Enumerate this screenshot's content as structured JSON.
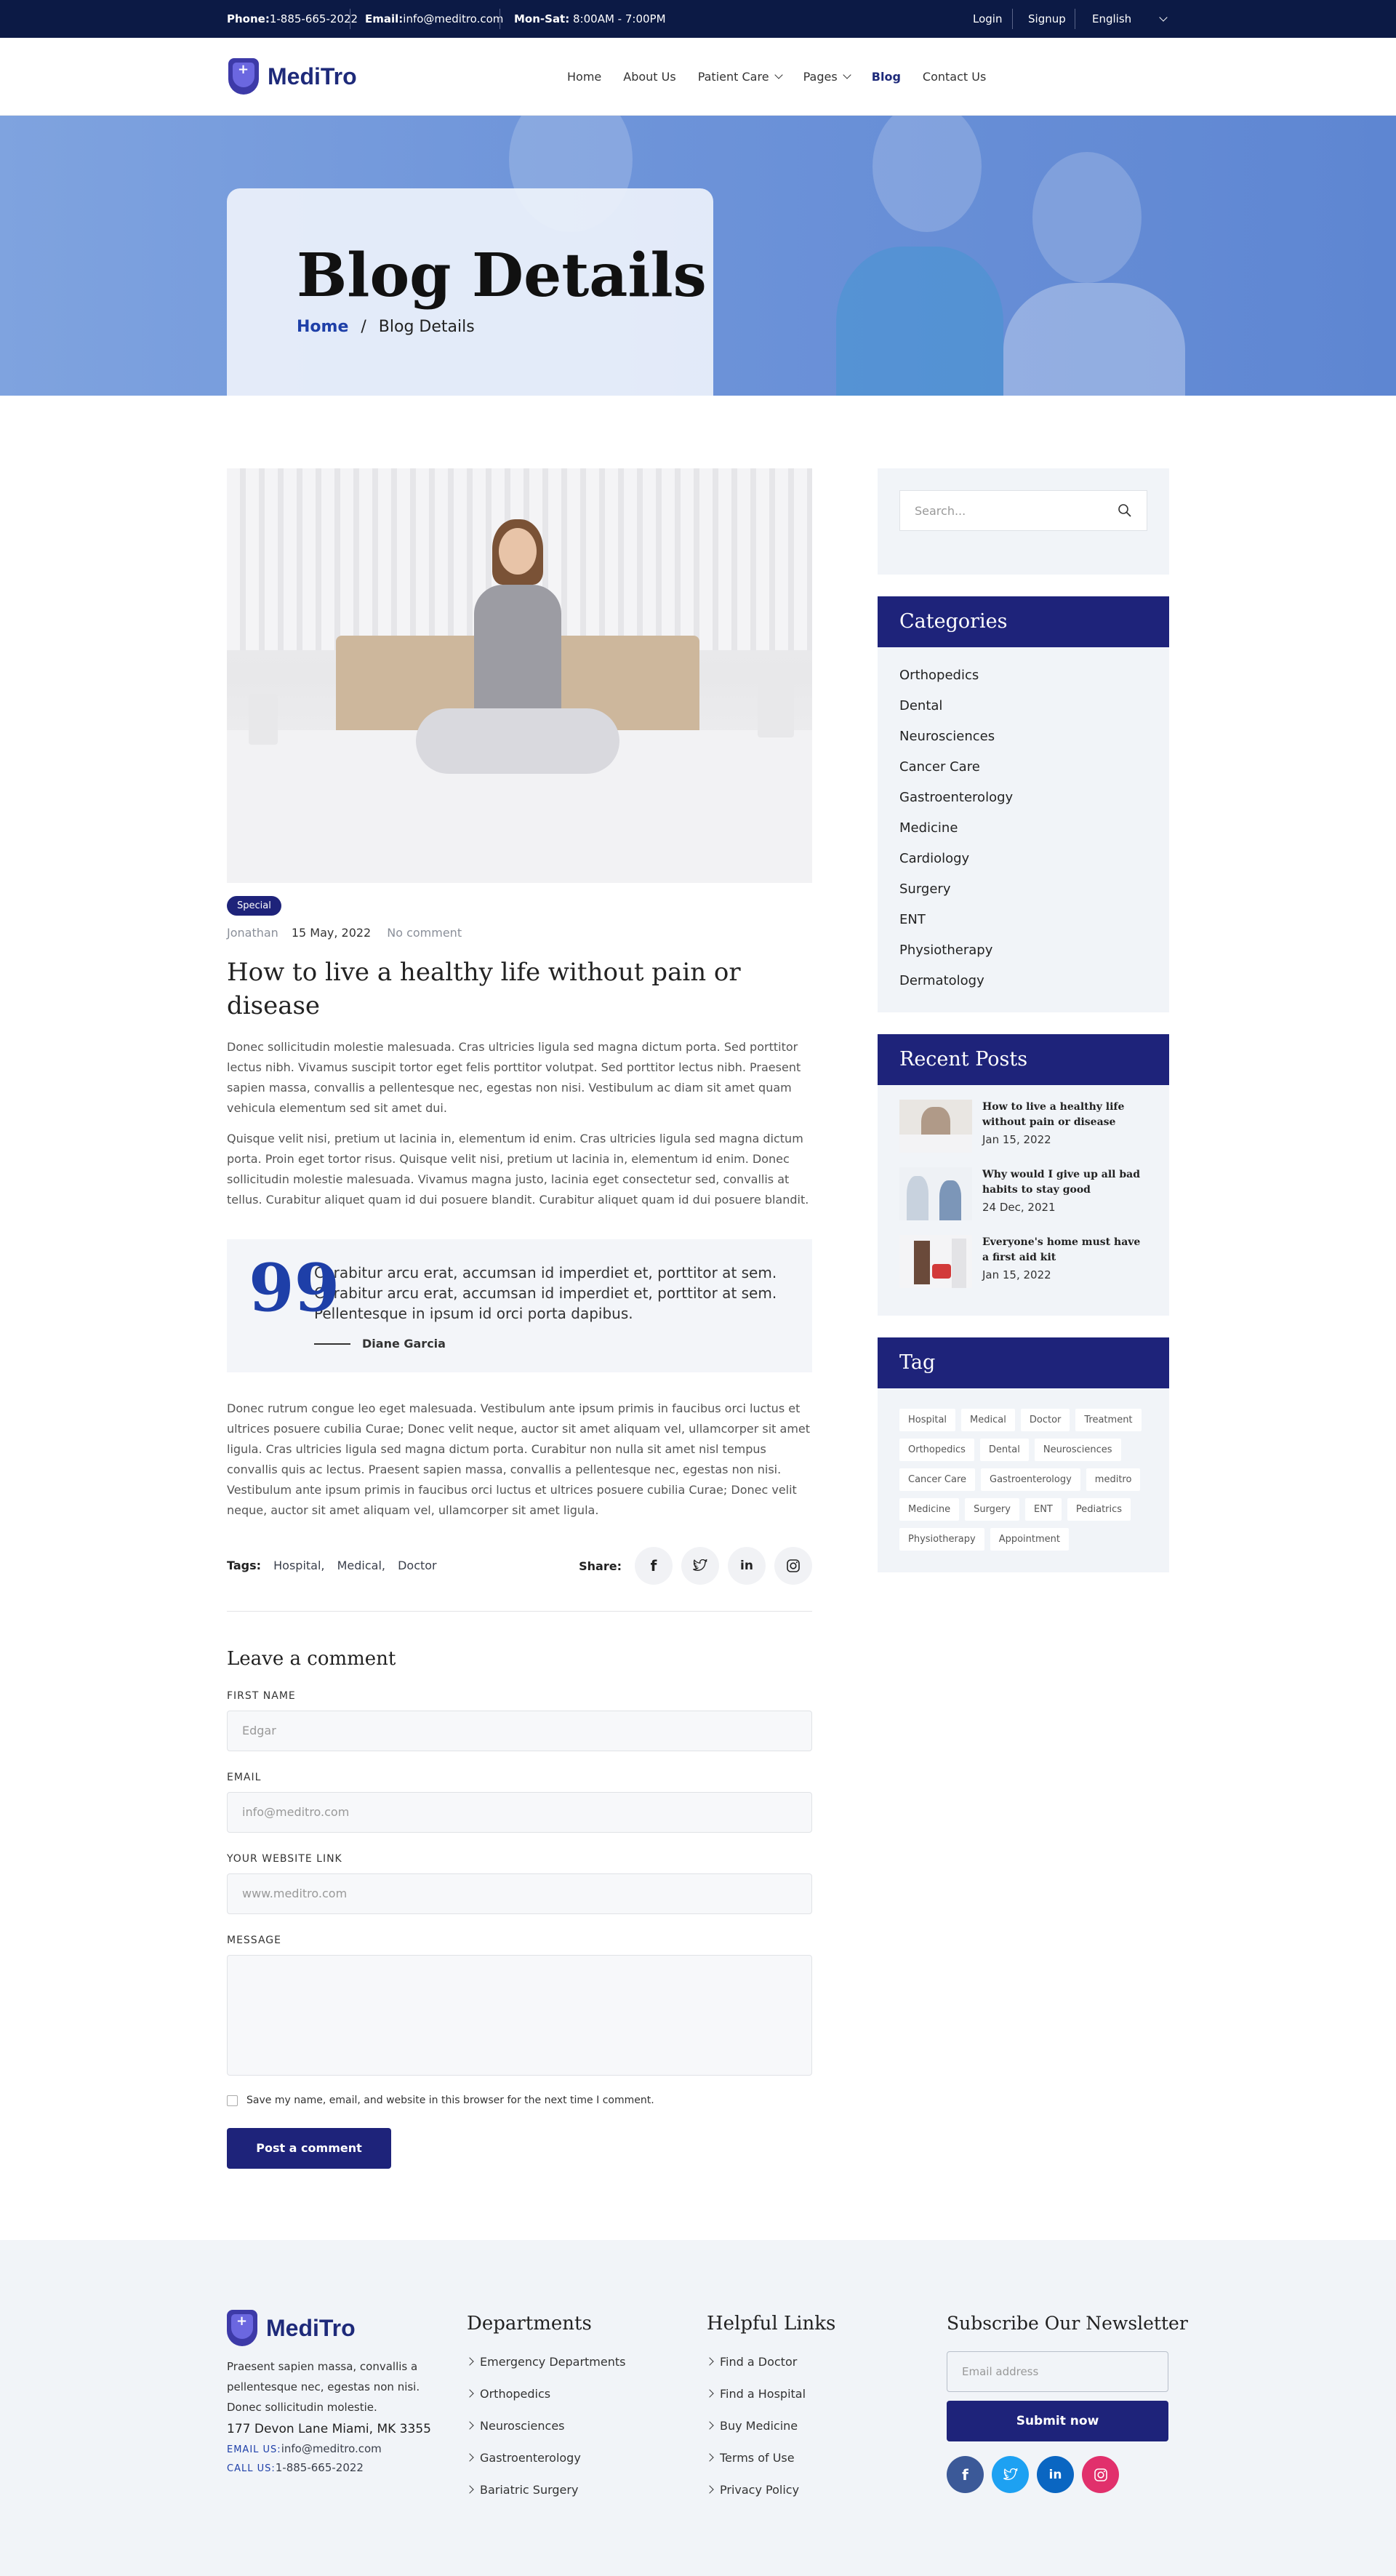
{
  "topbar": {
    "phone_label": "Phone:",
    "phone": "1-885-665-2022",
    "email_label": "Email:",
    "email": "info@meditro.com",
    "hours_label": "Mon-Sat:",
    "hours": "8:00AM - 7:00PM",
    "login": "Login",
    "signup": "Signup",
    "language": "English"
  },
  "brand": {
    "name": "MediTro"
  },
  "nav": {
    "items": [
      "Home",
      "About Us",
      "Patient Care",
      "Pages",
      "Blog",
      "Contact Us"
    ],
    "active": "Blog"
  },
  "hero": {
    "title": "Blog Details",
    "crumb_home": "Home",
    "crumb_sep": "/",
    "crumb_current": "Blog Details"
  },
  "post": {
    "category": "Special",
    "author": "Jonathan",
    "date": "15 May, 2022",
    "comments": "No comment",
    "title": "How to live a healthy life without pain or disease",
    "para1": "Donec sollicitudin molestie malesuada. Cras ultricies ligula sed magna dictum porta. Sed porttitor lectus nibh. Vivamus suscipit tortor eget felis porttitor volutpat. Sed porttitor lectus nibh. Praesent sapien massa, convallis a pellentesque nec, egestas non nisi. Vestibulum ac diam sit amet quam vehicula elementum sed sit amet dui.",
    "para2": "Quisque velit nisi, pretium ut lacinia in, elementum id enim. Cras ultricies ligula sed magna dictum porta. Proin eget tortor risus. Quisque velit nisi, pretium ut lacinia in, elementum id enim. Donec sollicitudin molestie malesuada. Vivamus magna justo, lacinia eget consectetur sed, convallis at tellus. Curabitur aliquet quam id dui posuere blandit. Curabitur aliquet quam id dui posuere blandit.",
    "quote": "Curabitur arcu erat, accumsan id imperdiet et, porttitor at sem. Curabitur arcu erat, accumsan id imperdiet et, porttitor at sem. Pellentesque in ipsum id orci porta dapibus.",
    "quote_author": "Diane Garcia",
    "para3": "Donec rutrum congue leo eget malesuada. Vestibulum ante ipsum primis in faucibus orci luctus et ultrices posuere cubilia Curae; Donec velit neque, auctor sit amet aliquam vel, ullamcorper sit amet ligula. Cras ultricies ligula sed magna dictum porta. Curabitur non nulla sit amet nisl tempus convallis quis ac lectus. Praesent sapien massa, convallis a pellentesque nec, egestas non nisi. Vestibulum ante ipsum primis in faucibus orci luctus et ultrices posuere cubilia Curae; Donec velit neque, auctor sit amet aliquam vel, ullamcorper sit amet ligula.",
    "tags_label": "Tags:",
    "tags": [
      "Hospital,",
      "Medical,",
      "Doctor"
    ],
    "share_label": "Share:"
  },
  "comment_form": {
    "title": "Leave a comment",
    "first_name_label": "FIRST NAME",
    "first_name_placeholder": "Edgar",
    "email_label": "EMAIL",
    "email_placeholder": "info@meditro.com",
    "website_label": "YOUR WEBSITE LINK",
    "website_placeholder": "www.meditro.com",
    "message_label": "MESSAGE",
    "save_info": "Save my name, email, and website in this browser for the next time I comment.",
    "submit": "Post a comment"
  },
  "sidebar": {
    "search_placeholder": "Search...",
    "categories_title": "Categories",
    "categories": [
      "Orthopedics",
      "Dental",
      "Neurosciences",
      "Cancer Care",
      "Gastroenterology",
      "Medicine",
      "Cardiology",
      "Surgery",
      "ENT",
      "Physiotherapy",
      "Dermatology"
    ],
    "recent_title": "Recent Posts",
    "recent": [
      {
        "title": "How to live a healthy life without pain or disease",
        "date": "Jan 15, 2022"
      },
      {
        "title": "Why would I give up all bad habits to stay good",
        "date": "24 Dec, 2021"
      },
      {
        "title": "Everyone's home must have a first aid kit",
        "date": "Jan 15, 2022"
      }
    ],
    "tag_title": "Tag",
    "tags": [
      "Hospital",
      "Medical",
      "Doctor",
      "Treatment",
      "Orthopedics",
      "Dental",
      "Neurosciences",
      "Cancer Care",
      "Gastroenterology",
      "meditro",
      "Medicine",
      "Surgery",
      "ENT",
      "Pediatrics",
      "Physiotherapy",
      "Appointment"
    ]
  },
  "footer": {
    "about": "Praesent sapien massa, convallis a pellentesque nec, egestas non nisi. Donec sollicitudin molestie.",
    "address": "177 Devon Lane Miami, MK 3355",
    "email_label": "EMAIL US:",
    "email": "info@meditro.com",
    "call_label": "CALL US:",
    "phone": "1-885-665-2022",
    "departments_title": "Departments",
    "departments": [
      "Emergency Departments",
      "Orthopedics",
      "Neurosciences",
      "Gastroenterology",
      "Bariatric Surgery"
    ],
    "helpful_title": "Helpful Links",
    "helpful": [
      "Find a Doctor",
      "Find a Hospital",
      "Buy Medicine",
      "Terms of Use",
      "Privacy Policy"
    ],
    "newsletter_title": "Subscribe Our Newsletter",
    "newsletter_placeholder": "Email address",
    "newsletter_button": "Submit now",
    "socials": [
      {
        "icon": "facebook-icon",
        "color": "#3b5998"
      },
      {
        "icon": "twitter-icon",
        "color": "#1da1f2"
      },
      {
        "icon": "linkedin-icon",
        "color": "#0a66c2"
      },
      {
        "icon": "instagram-icon",
        "color": "#e1306c"
      }
    ]
  },
  "colors": {
    "primary": "#1e237a",
    "topbar": "#0c1a45",
    "accent_blue": "#1e3fa8"
  }
}
